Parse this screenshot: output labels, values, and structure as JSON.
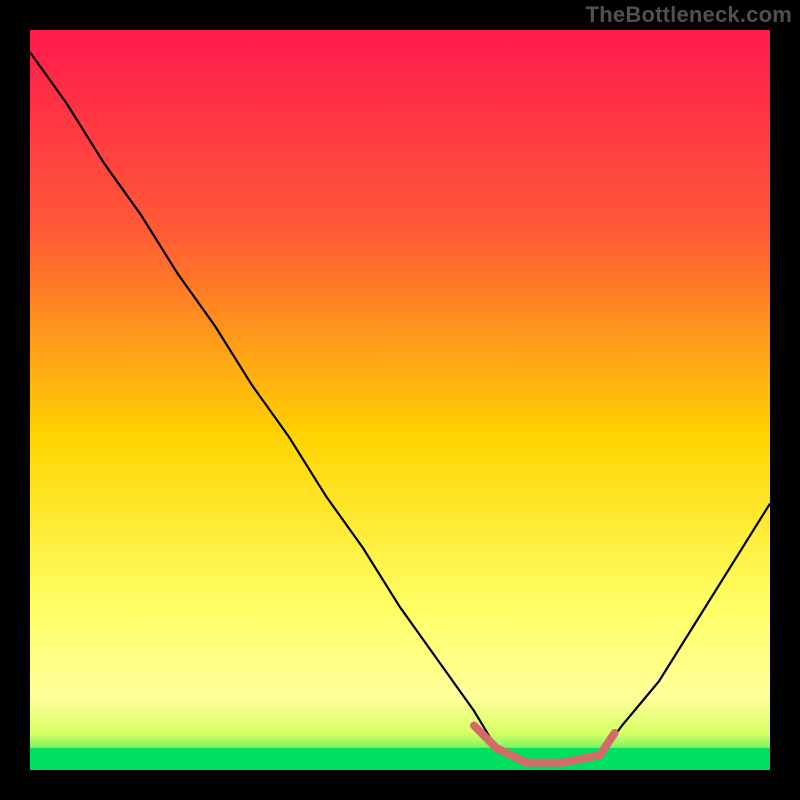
{
  "watermark": "TheBottleneck.com",
  "chart_data": {
    "type": "line",
    "title": "",
    "xlabel": "",
    "ylabel": "",
    "xlim": [
      0,
      100
    ],
    "ylim": [
      0,
      100
    ],
    "gradient_stops": [
      {
        "offset": 0,
        "color": "#ff1a4d"
      },
      {
        "offset": 27,
        "color": "#ff5a36"
      },
      {
        "offset": 55,
        "color": "#ffd400"
      },
      {
        "offset": 78,
        "color": "#ffff66"
      },
      {
        "offset": 90,
        "color": "#ffff99"
      },
      {
        "offset": 95,
        "color": "#d6ff66"
      },
      {
        "offset": 100,
        "color": "#00e060"
      }
    ],
    "series": [
      {
        "name": "bottleneck-curve",
        "stroke": "#000000",
        "x": [
          0,
          5,
          10,
          15,
          20,
          25,
          30,
          35,
          40,
          45,
          50,
          55,
          60,
          63,
          67,
          72,
          77,
          80,
          85,
          90,
          95,
          100
        ],
        "y": [
          97,
          90,
          82,
          75,
          67,
          60,
          52,
          45,
          37,
          30,
          22,
          15,
          8,
          3,
          1,
          1,
          2,
          6,
          12,
          20,
          28,
          36
        ]
      },
      {
        "name": "highlight-band",
        "stroke": "#d46a6a",
        "x": [
          60,
          63,
          67,
          72,
          77,
          79
        ],
        "y": [
          6,
          3,
          1,
          1,
          2,
          5
        ]
      }
    ],
    "green_band_y": [
      0,
      3
    ]
  }
}
